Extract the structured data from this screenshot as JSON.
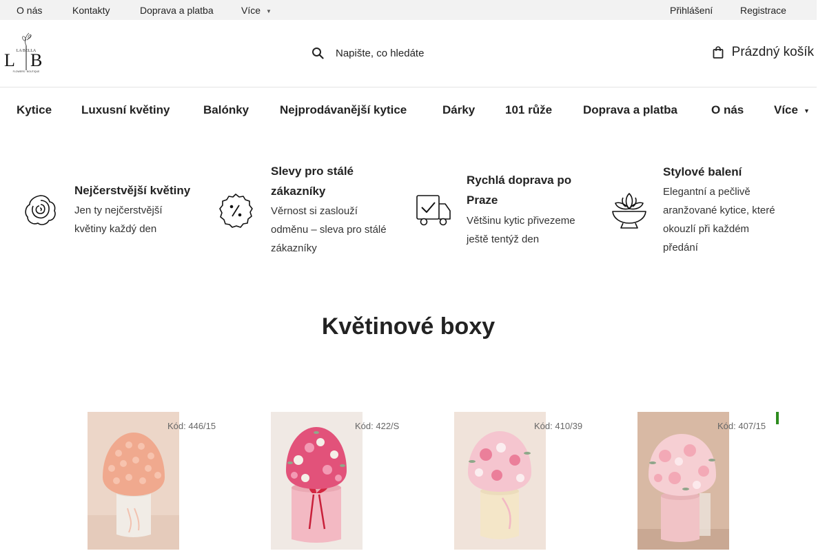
{
  "topbar": {
    "links": [
      "O nás",
      "Kontakty",
      "Doprava a platba"
    ],
    "more_label": "Více",
    "login_label": "Přihlášení",
    "register_label": "Registrace"
  },
  "header": {
    "logo_alt": "La Bella Flowers Boutique",
    "search_placeholder": "Napište, co hledáte",
    "cart_label": "Prázdný košík"
  },
  "nav": {
    "items": [
      "Kytice",
      "Luxusní květiny",
      "Balónky",
      "Nejprodávanější kytice",
      "Dárky",
      "101 růže",
      "Doprava a platba",
      "O nás"
    ],
    "more_label": "Více"
  },
  "features": [
    {
      "icon": "rose-icon",
      "title": "Nejčerstvější květiny",
      "desc": [
        "Jen ty nejčerstvější",
        "květiny každý den"
      ]
    },
    {
      "icon": "discount-badge-icon",
      "title": [
        "Slevy pro stálé",
        "zákazníky"
      ],
      "desc": [
        "Věrnost si zaslouží",
        "odměnu – sleva pro stálé",
        "zákazníky"
      ]
    },
    {
      "icon": "delivery-truck-icon",
      "title": [
        "Rychlá doprava po",
        "Praze"
      ],
      "desc": [
        "Většinu kytic přivezeme",
        "ještě tentýž den"
      ]
    },
    {
      "icon": "flower-bowl-icon",
      "title": "Stylové balení",
      "desc": [
        "Elegantní a pečlivě",
        "aranžované kytice, které",
        "okouzlí při každém",
        "předání"
      ]
    }
  ],
  "section": {
    "title": "Květinové boxy"
  },
  "products": [
    {
      "code": "Kód: 446/15",
      "image": "peach-spray-roses-in-white-box"
    },
    {
      "code": "Kód: 422/S",
      "image": "pink-roses-in-pink-box"
    },
    {
      "code": "Kód: 410/39",
      "image": "pink-carnations-in-cream-box"
    },
    {
      "code": "Kód: 407/15",
      "image": "pink-carnations-in-pink-box"
    }
  ],
  "colors": {
    "topbar_bg": "#f2f2f2",
    "accent": "#2d8c1e",
    "text": "#222222"
  }
}
